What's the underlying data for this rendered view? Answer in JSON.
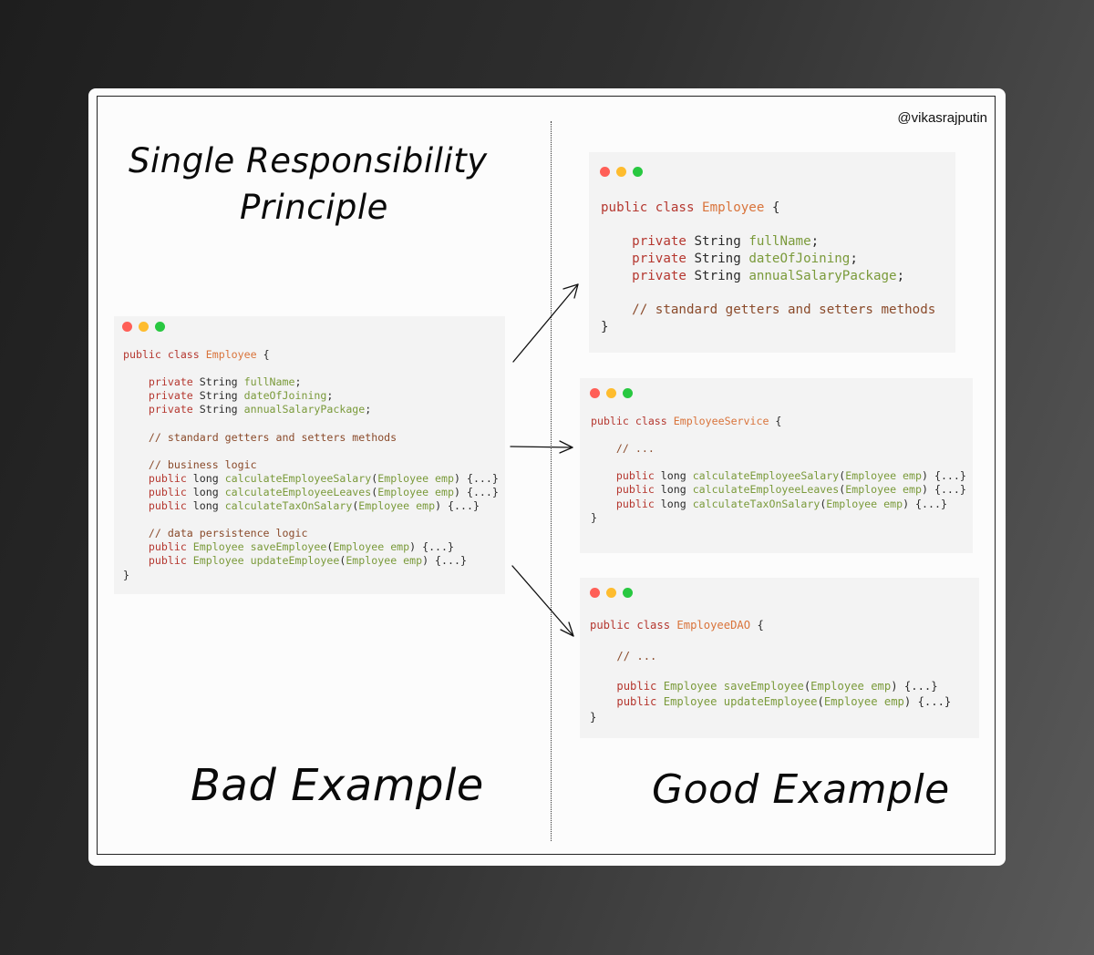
{
  "handle": "@vikasrajputin",
  "title": {
    "line1": "Single Responsibility",
    "line2": "Principle"
  },
  "labels": {
    "bad": "Bad Example",
    "good": "Good Example"
  },
  "code_blocks": {
    "bad": [
      [
        [
          "kw",
          "public class "
        ],
        [
          "cls",
          "Employee"
        ],
        [
          "txt",
          " {"
        ]
      ],
      [],
      [
        [
          "txt",
          "    "
        ],
        [
          "kw",
          "private"
        ],
        [
          "txt",
          " String "
        ],
        [
          "fld",
          "fullName"
        ],
        [
          "txt",
          ";"
        ]
      ],
      [
        [
          "txt",
          "    "
        ],
        [
          "kw",
          "private"
        ],
        [
          "txt",
          " String "
        ],
        [
          "fld",
          "dateOfJoining"
        ],
        [
          "txt",
          ";"
        ]
      ],
      [
        [
          "txt",
          "    "
        ],
        [
          "kw",
          "private"
        ],
        [
          "txt",
          " String "
        ],
        [
          "fld",
          "annualSalaryPackage"
        ],
        [
          "txt",
          ";"
        ]
      ],
      [],
      [
        [
          "txt",
          "    "
        ],
        [
          "cmt",
          "// standard getters and setters methods"
        ]
      ],
      [],
      [
        [
          "txt",
          "    "
        ],
        [
          "cmt",
          "// business logic"
        ]
      ],
      [
        [
          "txt",
          "    "
        ],
        [
          "kw",
          "public"
        ],
        [
          "txt",
          " long "
        ],
        [
          "mth",
          "calculateEmployeeSalary"
        ],
        [
          "txt",
          "("
        ],
        [
          "mth",
          "Employee emp"
        ],
        [
          "txt",
          ") {...}"
        ]
      ],
      [
        [
          "txt",
          "    "
        ],
        [
          "kw",
          "public"
        ],
        [
          "txt",
          " long "
        ],
        [
          "mth",
          "calculateEmployeeLeaves"
        ],
        [
          "txt",
          "("
        ],
        [
          "mth",
          "Employee emp"
        ],
        [
          "txt",
          ") {...}"
        ]
      ],
      [
        [
          "txt",
          "    "
        ],
        [
          "kw",
          "public"
        ],
        [
          "txt",
          " long "
        ],
        [
          "mth",
          "calculateTaxOnSalary"
        ],
        [
          "txt",
          "("
        ],
        [
          "mth",
          "Employee emp"
        ],
        [
          "txt",
          ") {...}"
        ]
      ],
      [],
      [
        [
          "txt",
          "    "
        ],
        [
          "cmt",
          "// data persistence logic"
        ]
      ],
      [
        [
          "txt",
          "    "
        ],
        [
          "kw",
          "public"
        ],
        [
          "txt",
          " "
        ],
        [
          "mth",
          "Employee saveEmployee"
        ],
        [
          "txt",
          "("
        ],
        [
          "mth",
          "Employee emp"
        ],
        [
          "txt",
          ") {...}"
        ]
      ],
      [
        [
          "txt",
          "    "
        ],
        [
          "kw",
          "public"
        ],
        [
          "txt",
          " "
        ],
        [
          "mth",
          "Employee updateEmployee"
        ],
        [
          "txt",
          "("
        ],
        [
          "mth",
          "Employee emp"
        ],
        [
          "txt",
          ") {...}"
        ]
      ],
      [
        [
          "txt",
          "}"
        ]
      ]
    ],
    "good_employee": [
      [
        [
          "kw",
          "public class "
        ],
        [
          "cls",
          "Employee"
        ],
        [
          "txt",
          " {"
        ]
      ],
      [],
      [
        [
          "txt",
          "    "
        ],
        [
          "kw",
          "private"
        ],
        [
          "txt",
          " String "
        ],
        [
          "fld",
          "fullName"
        ],
        [
          "txt",
          ";"
        ]
      ],
      [
        [
          "txt",
          "    "
        ],
        [
          "kw",
          "private"
        ],
        [
          "txt",
          " String "
        ],
        [
          "fld",
          "dateOfJoining"
        ],
        [
          "txt",
          ";"
        ]
      ],
      [
        [
          "txt",
          "    "
        ],
        [
          "kw",
          "private"
        ],
        [
          "txt",
          " String "
        ],
        [
          "fld",
          "annualSalaryPackage"
        ],
        [
          "txt",
          ";"
        ]
      ],
      [],
      [
        [
          "txt",
          "    "
        ],
        [
          "cmt",
          "// standard getters and setters methods"
        ]
      ],
      [
        [
          "txt",
          "}"
        ]
      ]
    ],
    "good_service": [
      [
        [
          "kw",
          "public class "
        ],
        [
          "cls",
          "EmployeeService"
        ],
        [
          "txt",
          " {"
        ]
      ],
      [],
      [
        [
          "txt",
          "    "
        ],
        [
          "cmt",
          "// ..."
        ]
      ],
      [],
      [
        [
          "txt",
          "    "
        ],
        [
          "kw",
          "public"
        ],
        [
          "txt",
          " long "
        ],
        [
          "mth",
          "calculateEmployeeSalary"
        ],
        [
          "txt",
          "("
        ],
        [
          "mth",
          "Employee emp"
        ],
        [
          "txt",
          ") {...}"
        ]
      ],
      [
        [
          "txt",
          "    "
        ],
        [
          "kw",
          "public"
        ],
        [
          "txt",
          " long "
        ],
        [
          "mth",
          "calculateEmployeeLeaves"
        ],
        [
          "txt",
          "("
        ],
        [
          "mth",
          "Employee emp"
        ],
        [
          "txt",
          ") {...}"
        ]
      ],
      [
        [
          "txt",
          "    "
        ],
        [
          "kw",
          "public"
        ],
        [
          "txt",
          " long "
        ],
        [
          "mth",
          "calculateTaxOnSalary"
        ],
        [
          "txt",
          "("
        ],
        [
          "mth",
          "Employee emp"
        ],
        [
          "txt",
          ") {...}"
        ]
      ],
      [
        [
          "txt",
          "}"
        ]
      ]
    ],
    "good_dao": [
      [
        [
          "kw",
          "public class "
        ],
        [
          "cls",
          "EmployeeDAO"
        ],
        [
          "txt",
          " {"
        ]
      ],
      [],
      [
        [
          "txt",
          "    "
        ],
        [
          "cmt",
          "// ..."
        ]
      ],
      [],
      [
        [
          "txt",
          "    "
        ],
        [
          "kw",
          "public"
        ],
        [
          "txt",
          " "
        ],
        [
          "mth",
          "Employee saveEmployee"
        ],
        [
          "txt",
          "("
        ],
        [
          "mth",
          "Employee emp"
        ],
        [
          "txt",
          ") {...}"
        ]
      ],
      [
        [
          "txt",
          "    "
        ],
        [
          "kw",
          "public"
        ],
        [
          "txt",
          " "
        ],
        [
          "mth",
          "Employee updateEmployee"
        ],
        [
          "txt",
          "("
        ],
        [
          "mth",
          "Employee emp"
        ],
        [
          "txt",
          ") {...}"
        ]
      ],
      [
        [
          "txt",
          "}"
        ]
      ]
    ]
  },
  "colors": {
    "keyword": "#b5372f",
    "class_name": "#d9733a",
    "identifier": "#7a9a3a",
    "comment": "#8a4a2a",
    "dot_red": "#ff5f57",
    "dot_yellow": "#febc2e",
    "dot_green": "#28c840"
  }
}
